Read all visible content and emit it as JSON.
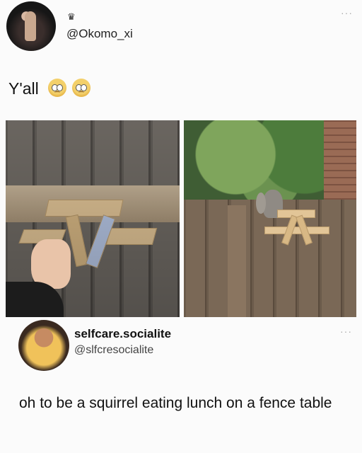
{
  "post": {
    "handle": "@Okomo_xi",
    "crown_glyph": "♛",
    "more_glyph": "···",
    "text": "Y'all",
    "emojis": [
      "pleading-face",
      "pleading-face"
    ]
  },
  "images": [
    {
      "name": "squirrel-picnic-table-held",
      "description": ""
    },
    {
      "name": "squirrel-eating-at-fence-table",
      "description": ""
    }
  ],
  "reply": {
    "display_name": "selfcare.socialite",
    "handle": "@slfcresocialite",
    "more_glyph": "···",
    "text": "oh to be a squirrel eating lunch on a fence table"
  }
}
